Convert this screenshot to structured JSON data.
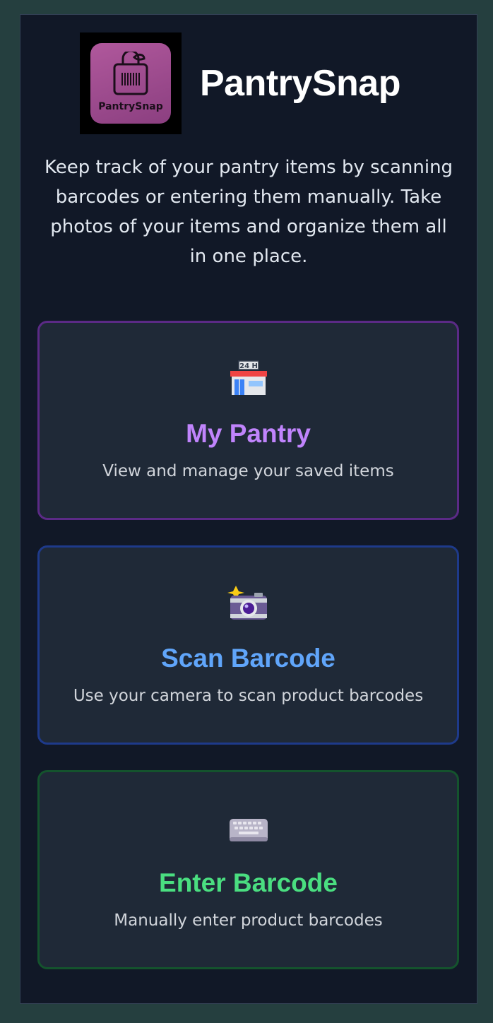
{
  "app": {
    "title": "PantrySnap",
    "logo_text": "PantrySnap",
    "intro": "Keep track of your pantry items by scanning barcodes or entering them manually. Take photos of your items and organize them all in one place."
  },
  "cards": [
    {
      "title": "My Pantry",
      "description": "View and manage your saved items",
      "icon": "convenience-store-icon",
      "accent": "#c084fc"
    },
    {
      "title": "Scan Barcode",
      "description": "Use your camera to scan product barcodes",
      "icon": "camera-flash-icon",
      "accent": "#60a5fa"
    },
    {
      "title": "Enter Barcode",
      "description": "Manually enter product barcodes",
      "icon": "keyboard-icon",
      "accent": "#4ade80"
    }
  ],
  "colors": {
    "page_background": "#253f3f",
    "panel_background": "#111827",
    "card_background": "#1f2937"
  }
}
